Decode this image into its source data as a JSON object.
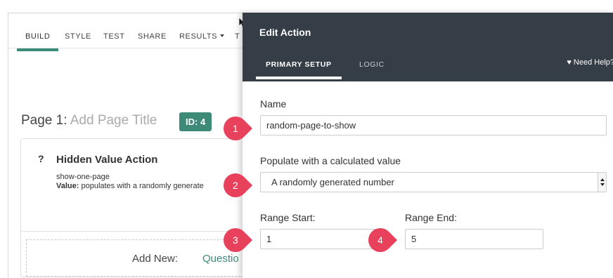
{
  "editor": {
    "tabs": [
      {
        "label": "BUILD"
      },
      {
        "label": "STYLE"
      },
      {
        "label": "TEST"
      },
      {
        "label": "SHARE"
      },
      {
        "label": "RESULTS"
      },
      {
        "label": "T"
      }
    ],
    "page": {
      "prefix": "Page 1:",
      "title_placeholder": "Add Page Title",
      "id_badge": "ID: 4"
    },
    "question": {
      "number": "?",
      "title": "Hidden Value Action",
      "slug": "show-one-page",
      "value_label": "Value:",
      "value_text": "populates with a randomly generate"
    },
    "add_new": {
      "label": "Add New:",
      "link": "Questio"
    }
  },
  "drawer": {
    "title": "Edit Action",
    "tabs": [
      {
        "label": "PRIMARY SETUP"
      },
      {
        "label": "LOGIC"
      }
    ],
    "help": "Need Help?",
    "fields": {
      "name_label": "Name",
      "name_value": "random-page-to-show",
      "calc_label": "Populate with a calculated value",
      "calc_value": "A randomly generated number",
      "range_start_label": "Range Start:",
      "range_start_value": "1",
      "range_end_label": "Range End:",
      "range_end_value": "5"
    }
  },
  "markers": [
    "1",
    "2",
    "3",
    "4"
  ],
  "colors": {
    "accent": "#3d8a79",
    "drawer_header": "#353d46",
    "marker": "#e8415c"
  }
}
